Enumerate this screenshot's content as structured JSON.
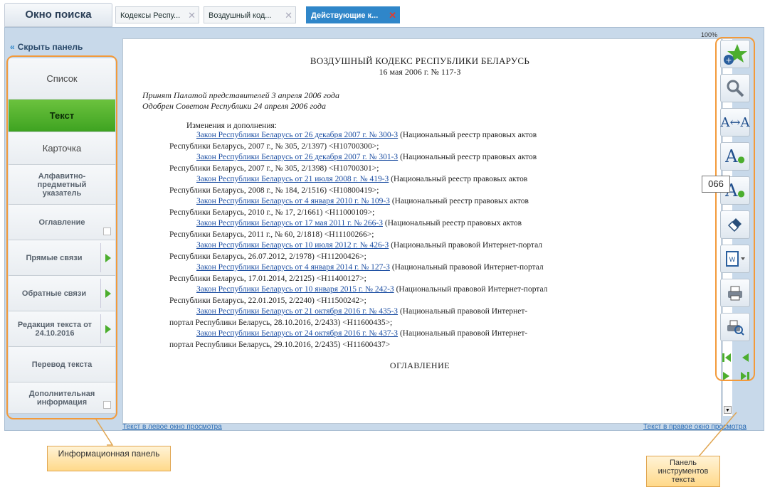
{
  "tabs": {
    "search_window": "Окно поиска",
    "docs": [
      {
        "label": "Кодексы Респу..."
      },
      {
        "label": "Воздушный код..."
      },
      {
        "label": "Действующие к..."
      }
    ]
  },
  "left_panel": {
    "hide_label": "Скрыть панель",
    "items": [
      {
        "label": "Список"
      },
      {
        "label": "Текст"
      },
      {
        "label": "Карточка"
      },
      {
        "label": "Алфавитно-предметный указатель"
      },
      {
        "label": "Оглавление"
      },
      {
        "label": "Прямые связи"
      },
      {
        "label": "Обратные связи"
      },
      {
        "label": "Редакция текста от 24.10.2016"
      },
      {
        "label": "Перевод текста"
      },
      {
        "label": "Дополнительная информация"
      }
    ]
  },
  "zoom": "100%",
  "document": {
    "title": "ВОЗДУШНЫЙ КОДЕКС РЕСПУБЛИКИ БЕЛАРУСЬ",
    "subtitle": "16 мая 2006 г. № 117-З",
    "adopted": "Принят Палатой представителей 3 апреля 2006 года",
    "approved": "Одобрен Советом Республики 24 апреля 2006 года",
    "changes_heading": "Изменения и дополнения:",
    "entries": [
      {
        "link": "Закон Республики Беларусь от 26 декабря 2007 г. № 300-З",
        "tail": " (Национальный реестр правовых актов",
        "cont": "Республики Беларусь, 2007 г., № 305, 2/1397) <H10700300>;"
      },
      {
        "link": "Закон Республики Беларусь от 26 декабря 2007 г. № 301-З",
        "tail": " (Национальный реестр правовых актов",
        "cont": "Республики Беларусь, 2007 г., № 305, 2/1398) <H10700301>;"
      },
      {
        "link": "Закон Республики Беларусь от 21 июля 2008 г. № 419-З",
        "tail": " (Национальный реестр правовых актов",
        "cont": "Республики Беларусь, 2008 г., № 184, 2/1516) <H10800419>;"
      },
      {
        "link": "Закон Республики Беларусь от 4 января 2010 г. № 109-З",
        "tail": " (Национальный реестр правовых актов",
        "cont": "Республики Беларусь, 2010 г., № 17, 2/1661) <H11000109>;"
      },
      {
        "link": "Закон Республики Беларусь от 17 мая 2011 г. № 266-З",
        "tail": " (Национальный реестр правовых актов",
        "cont": "Республики Беларусь, 2011 г., № 60, 2/1818) <H11100266>;"
      },
      {
        "link": "Закон Республики Беларусь от 10 июля 2012 г. № 426-З",
        "tail": " (Национальный правовой Интернет-портал",
        "cont": "Республики Беларусь, 26.07.2012, 2/1978) <H11200426>;"
      },
      {
        "link": "Закон Республики Беларусь от 4 января 2014 г. № 127-З",
        "tail": " (Национальный правовой Интернет-портал",
        "cont": "Республики Беларусь, 17.01.2014, 2/2125) <H11400127>;"
      },
      {
        "link": "Закон Республики Беларусь от 10 января 2015 г. № 242-З",
        "tail": " (Национальный правовой Интернет-портал",
        "cont": "Республики Беларусь, 22.01.2015, 2/2240) <H11500242>;"
      },
      {
        "link": "Закон Республики Беларусь от 21 октября 2016 г. № 435-З",
        "tail": " (Национальный правовой Интернет-",
        "cont": "портал Республики Беларусь, 28.10.2016, 2/2433) <H11600435>;"
      },
      {
        "link": "Закон Республики Беларусь от 24 октября 2016 г. № 437-З",
        "tail": " (Национальный правовой Интернет-",
        "cont": "портал Республики Беларусь, 29.10.2016, 2/2435) <H11600437>"
      }
    ],
    "toc_heading": "ОГЛАВЛЕНИЕ"
  },
  "footer": {
    "left_link": "Текст в левое окно просмотра",
    "right_link": "Текст в правое окно просмотра"
  },
  "toolbar": {
    "tooltip": "066",
    "icons": [
      "add-bookmark-icon",
      "search-icon",
      "font-size-icon",
      "increase-font-icon",
      "decrease-font-icon",
      "eraser-icon",
      "export-word-icon",
      "print-icon",
      "print-preview-icon",
      "first-icon",
      "prev-icon",
      "next-icon",
      "last-icon"
    ]
  },
  "callouts": {
    "info_panel": "Информационная панель",
    "text_tools": "Панель инструментов текста"
  },
  "colors": {
    "accent": "#2f86c9",
    "active_green": "#4cae2e",
    "highlight_orange": "#f39a3a"
  }
}
